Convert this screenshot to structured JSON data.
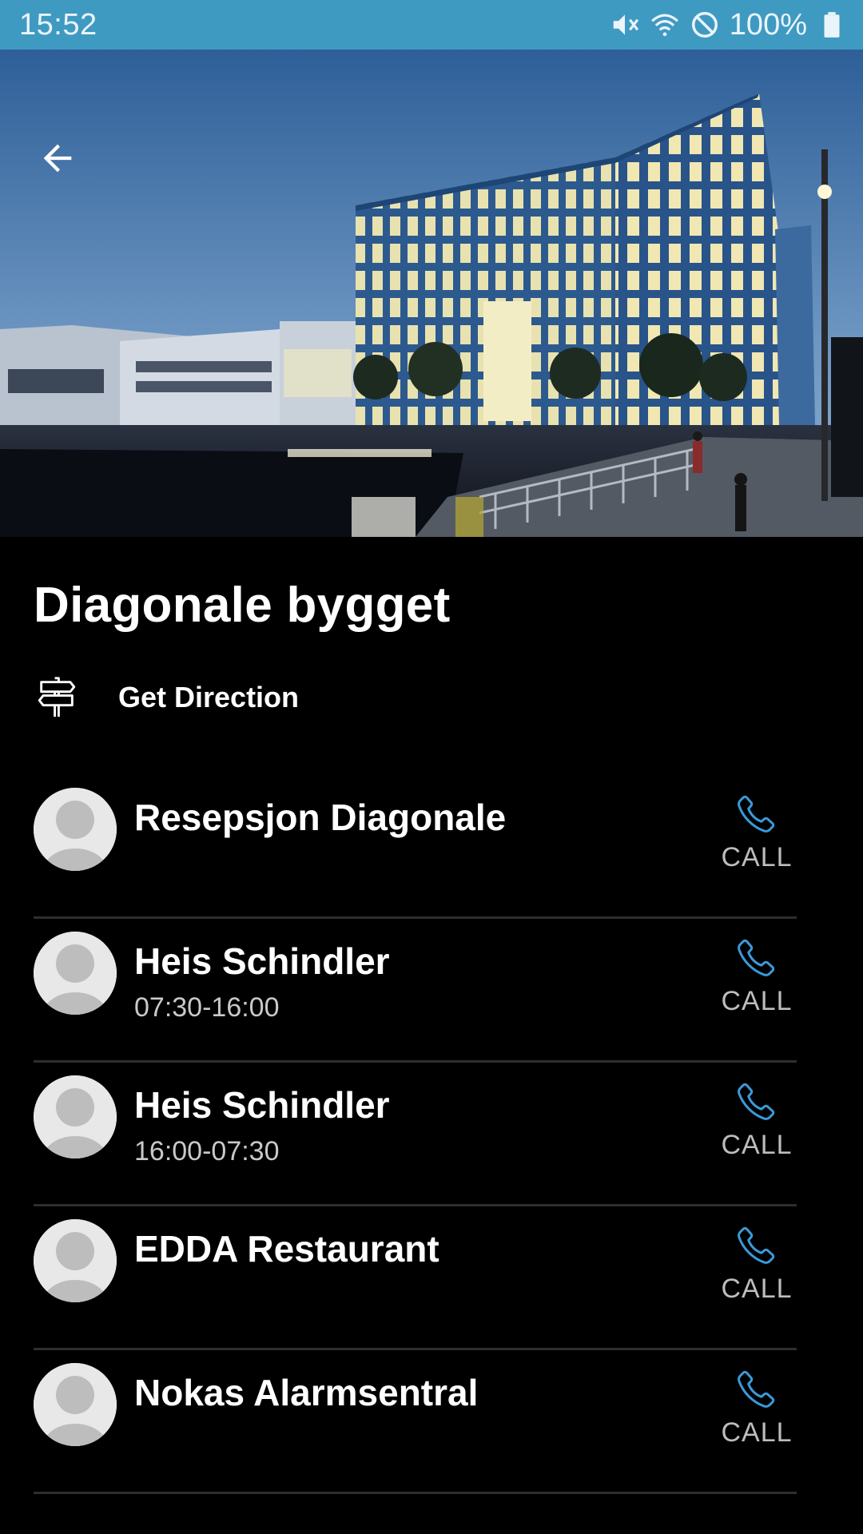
{
  "status_bar": {
    "time": "15:52",
    "battery": "100%",
    "icons": [
      "mute-icon",
      "wifi-icon",
      "do-not-disturb-icon",
      "battery-icon"
    ]
  },
  "header": {
    "back_icon": "arrow-left-icon"
  },
  "building": {
    "title": "Diagonale bygget",
    "direction_label": "Get Direction",
    "direction_icon": "signpost-icon"
  },
  "contacts": [
    {
      "name": "Resepsjon Diagonale",
      "hours": "",
      "action": "CALL"
    },
    {
      "name": "Heis Schindler",
      "hours": "07:30-16:00",
      "action": "CALL"
    },
    {
      "name": "Heis Schindler",
      "hours": "16:00-07:30",
      "action": "CALL"
    },
    {
      "name": "EDDA Restaurant",
      "hours": "",
      "action": "CALL"
    },
    {
      "name": "Nokas Alarmsentral",
      "hours": "",
      "action": "CALL"
    }
  ],
  "colors": {
    "status_bar": "#3f9ac2",
    "background": "#000000",
    "accent_call": "#3a9ad9",
    "divider": "#2e2e2e"
  }
}
